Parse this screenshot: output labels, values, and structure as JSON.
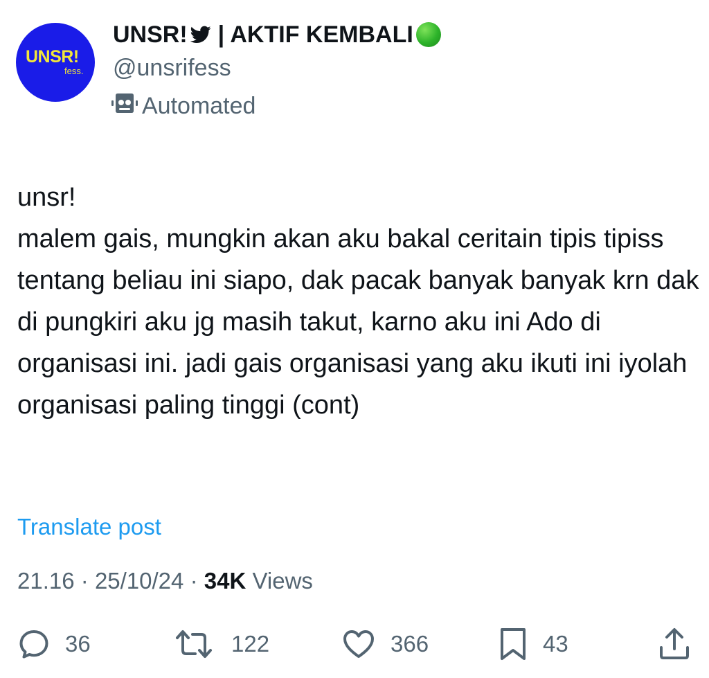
{
  "account": {
    "avatar_text": "UNSR!",
    "avatar_subtext": "fess.",
    "display_name": "UNSR!",
    "display_name_suffix": "| AKTIF KEMBALI",
    "handle": "@unsrifess",
    "automated_label": "Automated"
  },
  "tweet": {
    "text": "unsr!\nmalem gais, mungkin akan aku bakal ceritain tipis tipiss tentang beliau ini siapo, dak pacak banyak banyak krn dak di pungkiri aku jg masih takut, karno aku ini Ado di organisasi ini. jadi gais organisasi yang aku ikuti ini iyolah organisasi paling tinggi (cont)",
    "translate_label": "Translate post",
    "time": "21.16",
    "date": "25/10/24",
    "views_count": "34K",
    "views_label": "Views",
    "separator": "·"
  },
  "actions": {
    "replies": "36",
    "reposts": "122",
    "likes": "366",
    "bookmarks": "43"
  },
  "icons": {
    "bird": "bird-icon",
    "status": "green-circle-icon",
    "automated": "robot-icon",
    "reply": "reply-icon",
    "repost": "repost-icon",
    "like": "heart-icon",
    "bookmark": "bookmark-icon",
    "share": "share-icon"
  },
  "colors": {
    "text": "#0f1419",
    "secondary": "#536471",
    "link": "#1d9bf0",
    "avatar_bg": "#1a1ce8",
    "avatar_text": "#f2e63a",
    "status_green": "#2db32a"
  }
}
